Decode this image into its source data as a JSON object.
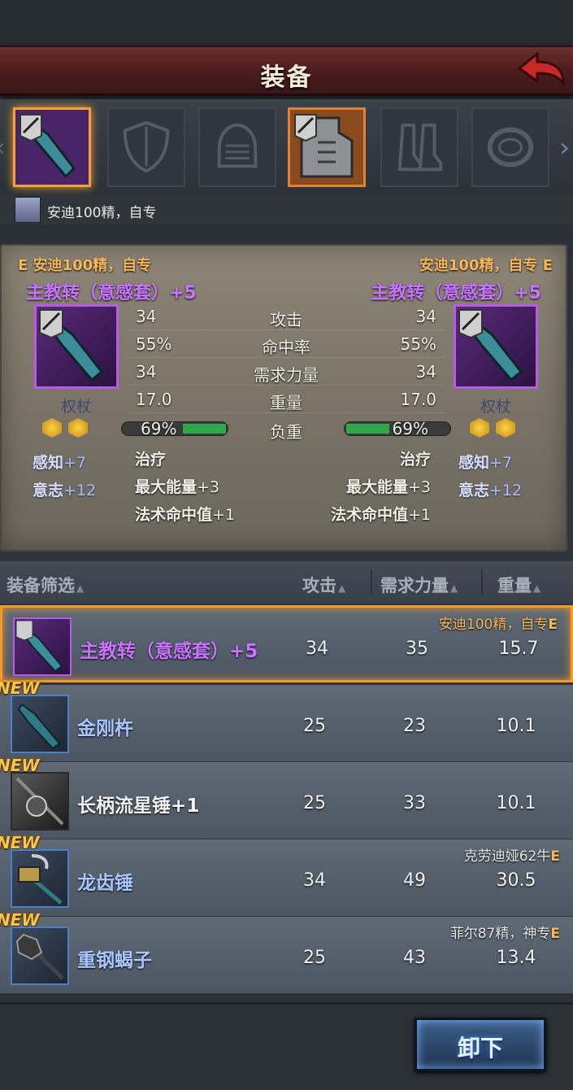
{
  "header": {
    "title": "装备"
  },
  "slots": {
    "items": [
      {
        "name": "weapon-slot",
        "icon": "scepter-icon",
        "selected": true
      },
      {
        "name": "shield-slot",
        "icon": "shield-icon"
      },
      {
        "name": "helmet-slot",
        "icon": "helmet-icon"
      },
      {
        "name": "armor-slot",
        "icon": "armor-icon"
      },
      {
        "name": "boots-slot",
        "icon": "boots-icon"
      },
      {
        "name": "ring-slot",
        "icon": "ring-icon"
      }
    ],
    "owner_label": "安迪100精，自专"
  },
  "compare": {
    "left": {
      "owner": "E 安迪100精，自专",
      "item_name": "主教转（意感套）+5",
      "type": "权杖",
      "attack": "34",
      "hit": "55%",
      "strength": "34",
      "weight": "17.0",
      "load": "69%",
      "load_fraction": 0.69,
      "attrs": [
        {
          "k": "感知",
          "v": "+7"
        },
        {
          "k": "意志",
          "v": "+12"
        }
      ],
      "subs": [
        {
          "k": "治疗",
          "v": ""
        },
        {
          "k": "最大能量",
          "v": "+3"
        },
        {
          "k": "法术命中值",
          "v": "+1"
        }
      ]
    },
    "right": {
      "owner": "安迪100精，自专 E",
      "item_name": "主教转（意感套）+5",
      "type": "权杖",
      "attack": "34",
      "hit": "55%",
      "strength": "34",
      "weight": "17.0",
      "load": "69%",
      "load_fraction": 0.69,
      "attrs": [
        {
          "k": "感知",
          "v": "+7"
        },
        {
          "k": "意志",
          "v": "+12"
        }
      ],
      "subs": [
        {
          "k": "治疗",
          "v": ""
        },
        {
          "k": "最大能量",
          "v": "+3"
        },
        {
          "k": "法术命中值",
          "v": "+1"
        }
      ]
    },
    "labels": {
      "attack": "攻击",
      "hit": "命中率",
      "strength": "需求力量",
      "weight": "重量",
      "load": "负重"
    }
  },
  "list": {
    "headers": {
      "filter": "装备筛选",
      "attack": "攻击",
      "strength": "需求力量",
      "weight": "重量"
    },
    "rows": [
      {
        "name": "主教转（意感套）+5",
        "attack": "34",
        "strength": "35",
        "weight": "15.7",
        "equipped_by": "安迪100精，自专",
        "eq_mark": "E",
        "new": "",
        "style": "purple"
      },
      {
        "name": "金刚杵",
        "attack": "25",
        "strength": "23",
        "weight": "10.1",
        "equipped_by": "",
        "eq_mark": "",
        "new": "NEW",
        "style": "blue"
      },
      {
        "name": "长柄流星锤+1",
        "attack": "25",
        "strength": "33",
        "weight": "10.1",
        "equipped_by": "",
        "eq_mark": "",
        "new": "NEW",
        "style": "dark"
      },
      {
        "name": "龙齿锤",
        "attack": "34",
        "strength": "49",
        "weight": "30.5",
        "equipped_by": "克劳迪娅62牛",
        "eq_mark": "E",
        "new": "NEW",
        "style": "blue"
      },
      {
        "name": "重钢蝎子",
        "attack": "25",
        "strength": "43",
        "weight": "13.4",
        "equipped_by": "菲尔87精，神专",
        "eq_mark": "E",
        "new": "NEW",
        "style": "blue"
      }
    ]
  },
  "footer": {
    "unequip_label": "卸下"
  }
}
